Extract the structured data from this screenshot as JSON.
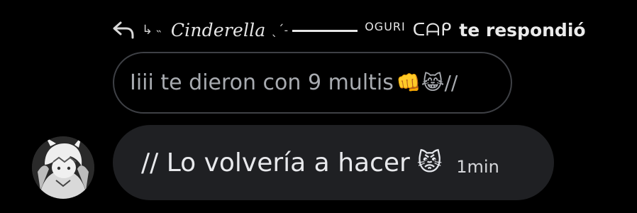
{
  "reply_header": {
    "icon": "reply-arrow-icon",
    "prefix_symbols": "↳ ˵",
    "replied_user_name": "Cinderella",
    "name_suffix_symbols": "ˎˊ˗",
    "brand_small": "OGURI",
    "brand_large": "ᑕᗩᑭ",
    "action_text": "te respondió"
  },
  "quoted_message": {
    "text": "Iiii te dieron con 9 multis",
    "emojis": "👊😹//"
  },
  "message": {
    "text": "// Lo volvería a hacer",
    "emoji": "😾",
    "timestamp": "1min"
  },
  "avatar": {
    "icon": "user-avatar-icon"
  },
  "colors": {
    "background": "#000000",
    "bubble": "#1f2023",
    "quoted_border": "#3e4045",
    "quoted_text": "#a8abb0",
    "text": "#e8e9ec"
  }
}
